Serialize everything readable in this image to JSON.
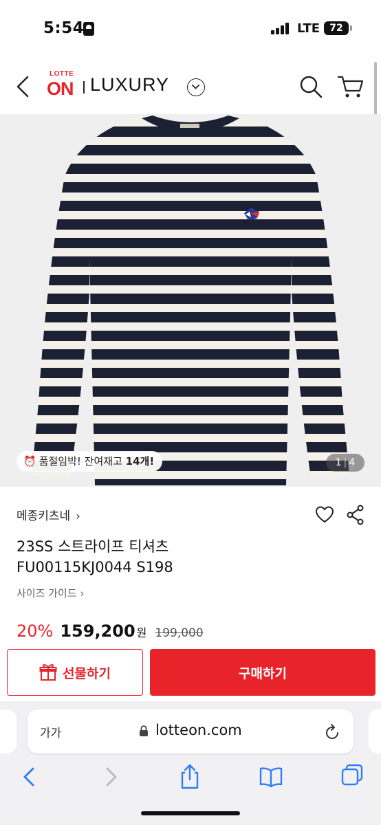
{
  "status_bar": {
    "time": "5:54",
    "network": "LTE",
    "battery": "72"
  },
  "header": {
    "logo_small": "LOTTE",
    "logo_large": "ON",
    "section": "LUXURY",
    "icons": [
      "back-icon",
      "chevron-down-icon",
      "search-icon",
      "cart-icon"
    ]
  },
  "gallery": {
    "stock_notice_prefix": "품절임박! 잔여재고 ",
    "stock_count": "14개!",
    "page_current": "1",
    "page_total": "4",
    "colors": {
      "navy": "#1c2033",
      "cream": "#f4f1ea"
    }
  },
  "product": {
    "brand": "메종키츠네",
    "title_line1": "23SS 스트라이프 티셔츠",
    "title_line2": "FU00115KJ0044 S198",
    "size_guide": "사이즈 가이드",
    "discount": "20%",
    "price": "159,200",
    "currency": "원",
    "original_price": "199,000"
  },
  "actions": {
    "gift_label": "선물하기",
    "buy_label": "구매하기",
    "accent": "#e8232a"
  },
  "browser": {
    "text_size": "가가",
    "url": "lotteon.com"
  }
}
